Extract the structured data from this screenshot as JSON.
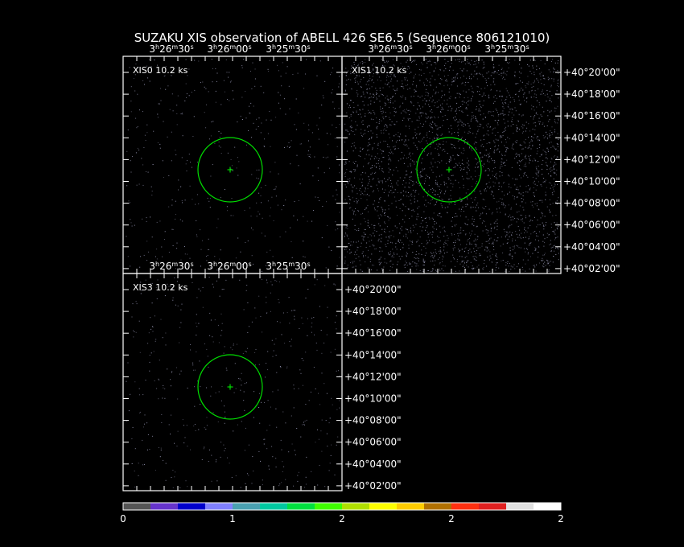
{
  "title": "SUZAKU XIS observation of ABELL 426 SE6.5  (Sequence 806121010)",
  "panels": [
    {
      "label": "XIS0 10.2 ks",
      "density": "low"
    },
    {
      "label": "XIS1 10.2 ks",
      "density": "high"
    },
    {
      "label": "XIS3 10.2 ks",
      "density": "low"
    }
  ],
  "ra_ticks": [
    {
      "h": "3",
      "m": "26",
      "s": "30"
    },
    {
      "h": "3",
      "m": "26",
      "s": "00"
    },
    {
      "h": "3",
      "m": "25",
      "s": "30"
    }
  ],
  "dec_ticks": [
    "+40°20'00\"",
    "+40°18'00\"",
    "+40°16'00\"",
    "+40°14'00\"",
    "+40°12'00\"",
    "+40°10'00\"",
    "+40°08'00\"",
    "+40°06'00\"",
    "+40°04'00\"",
    "+40°02'00\""
  ],
  "colorbar": {
    "colors": [
      "#555555",
      "#6633cc",
      "#0000cc",
      "#8080ff",
      "#4aa0b0",
      "#00c8a0",
      "#00e040",
      "#40ff00",
      "#b0e000",
      "#ffff00",
      "#ffcc00",
      "#b07000",
      "#ff3010",
      "#e02020",
      "#e0e0e0",
      "#ffffff"
    ],
    "labels": [
      "0",
      "1",
      "2",
      "2",
      "2"
    ]
  },
  "colors": {
    "region_circle": "#00dd00",
    "frame": "#ffffff",
    "photon": "#9a9ab8"
  }
}
